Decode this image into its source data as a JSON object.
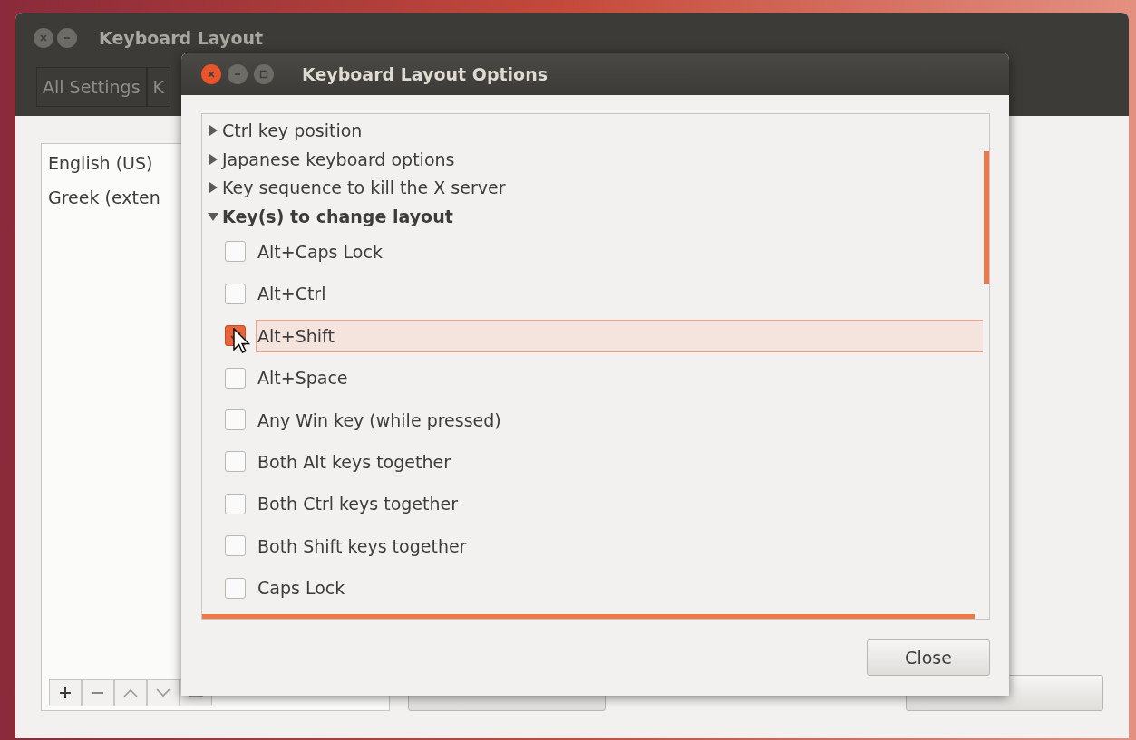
{
  "background_window": {
    "title": "Keyboard Layout",
    "toolbar": [
      {
        "label": "All Settings"
      },
      {
        "label": "K"
      }
    ],
    "layouts": [
      {
        "label": "English (US)",
        "selected": false
      },
      {
        "label": "Greek (exten",
        "selected": false
      }
    ]
  },
  "dialog": {
    "title": "Keyboard Layout Options",
    "options": [
      {
        "label": "Ctrl key position",
        "expanded": false
      },
      {
        "label": "Japanese keyboard options",
        "expanded": false
      },
      {
        "label": "Key sequence to kill the X server",
        "expanded": false
      },
      {
        "label": "Key(s) to change layout",
        "expanded": true,
        "children": [
          {
            "label": "Alt+Caps Lock",
            "checked": false,
            "selected": false
          },
          {
            "label": "Alt+Ctrl",
            "checked": false,
            "selected": false
          },
          {
            "label": "Alt+Shift",
            "checked": true,
            "selected": true
          },
          {
            "label": "Alt+Space",
            "checked": false,
            "selected": false
          },
          {
            "label": "Any Win key (while pressed)",
            "checked": false,
            "selected": false
          },
          {
            "label": "Both Alt keys together",
            "checked": false,
            "selected": false
          },
          {
            "label": "Both Ctrl keys together",
            "checked": false,
            "selected": false
          },
          {
            "label": "Both Shift keys together",
            "checked": false,
            "selected": false
          },
          {
            "label": "Caps Lock",
            "checked": false,
            "selected": false
          }
        ]
      }
    ],
    "close_button": "Close"
  }
}
